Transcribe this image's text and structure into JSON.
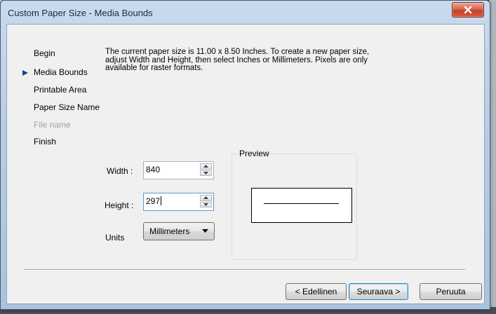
{
  "window": {
    "title": "Custom Paper Size - Media Bounds"
  },
  "nav": {
    "items": [
      {
        "label": "Begin",
        "state": "normal"
      },
      {
        "label": "Media Bounds",
        "state": "current"
      },
      {
        "label": "Printable Area",
        "state": "normal"
      },
      {
        "label": "Paper Size Name",
        "state": "normal"
      },
      {
        "label": "File name",
        "state": "disabled"
      },
      {
        "label": "Finish",
        "state": "normal"
      }
    ]
  },
  "description": "The current paper size is 11.00 x 8.50 Inches. To create a new paper size, adjust Width and Height, then select Inches or Millimeters. Pixels are only available for raster formats.",
  "form": {
    "width_label": "Width :",
    "width_value": "840",
    "height_label": "Height :",
    "height_value": "297",
    "units_label": "Units",
    "units_value": "Millimeters"
  },
  "preview": {
    "legend": "Preview"
  },
  "buttons": {
    "back": "< Edellinen",
    "next": "Seuraava >",
    "cancel": "Peruuta"
  },
  "colors": {
    "accent": "#1a3f8a",
    "close_button": "#c6402a"
  },
  "icons": {
    "current_step": "triangle-right-icon",
    "close": "close-icon"
  }
}
